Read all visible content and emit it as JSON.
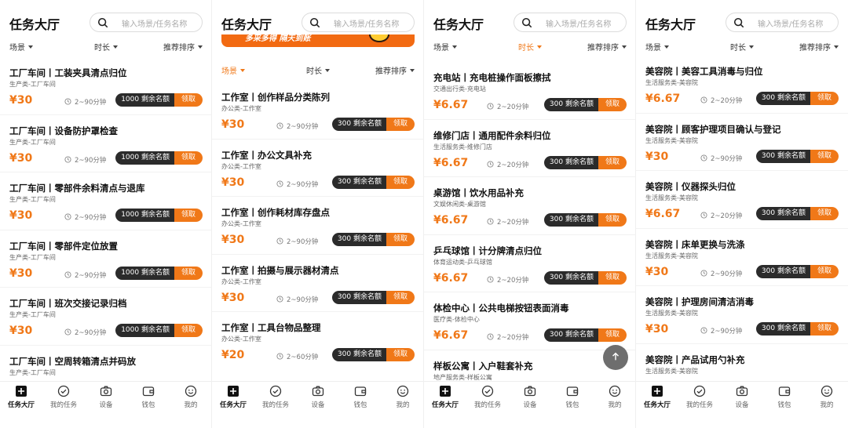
{
  "header": {
    "title": "任务大厅",
    "search_placeholder": "输入场景/任务名称"
  },
  "filters": {
    "scene": "场景",
    "duration": "时长",
    "sort": "推荐排序"
  },
  "banner": {
    "text": "多采多得 隔天到账"
  },
  "labels": {
    "remaining": "剩余名额",
    "claim": "领取"
  },
  "tabs": [
    "任务大厅",
    "我的任务",
    "设备",
    "钱包",
    "我的"
  ],
  "colors": {
    "accent": "#f07818",
    "quota_bg": "#2b2b2b",
    "fab": "#6e6e6e"
  },
  "fab_icon": "arrow-up-icon",
  "panels": [
    {
      "active_filter": "none",
      "tasks": [
        {
          "name": "工厂车间丨工装夹具清点归位",
          "category": "生产类-工厂车间",
          "price": "¥30",
          "time": "2~90分钟",
          "quota": "1000"
        },
        {
          "name": "工厂车间丨设备防护罩检查",
          "category": "生产类-工厂车间",
          "price": "¥30",
          "time": "2~90分钟",
          "quota": "1000"
        },
        {
          "name": "工厂车间丨零部件余料清点与退库",
          "category": "生产类-工厂车间",
          "price": "¥30",
          "time": "2~90分钟",
          "quota": "1000"
        },
        {
          "name": "工厂车间丨零部件定位放置",
          "category": "生产类-工厂车间",
          "price": "¥30",
          "time": "2~90分钟",
          "quota": "1000"
        },
        {
          "name": "工厂车间丨班次交接记录归档",
          "category": "生产类-工厂车间",
          "price": "¥30",
          "time": "2~90分钟",
          "quota": "1000"
        },
        {
          "name": "工厂车间丨空周转箱清点并码放",
          "category": "生产类-工厂车间",
          "price": "¥30",
          "time": "2~90分钟",
          "quota": "1000"
        }
      ]
    },
    {
      "active_filter": "scene",
      "tasks": [
        {
          "name": "工作室丨创作样品分类陈列",
          "category": "办公类-工作室",
          "price": "¥30",
          "time": "2~90分钟",
          "quota": "300"
        },
        {
          "name": "工作室丨办公文具补充",
          "category": "办公类-工作室",
          "price": "¥30",
          "time": "2~90分钟",
          "quota": "300"
        },
        {
          "name": "工作室丨创作耗材库存盘点",
          "category": "办公类-工作室",
          "price": "¥30",
          "time": "2~90分钟",
          "quota": "300"
        },
        {
          "name": "工作室丨拍摄与展示器材清点",
          "category": "办公类-工作室",
          "price": "¥30",
          "time": "2~90分钟",
          "quota": "300"
        },
        {
          "name": "工作室丨工具台物品整理",
          "category": "办公类-工作室",
          "price": "¥20",
          "time": "2~60分钟",
          "quota": "300"
        }
      ]
    },
    {
      "active_filter": "duration",
      "tasks": [
        {
          "name": "充电站丨充电桩操作面板擦拭",
          "category": "交通出行类-充电站",
          "price": "¥6.67",
          "time": "2~20分钟",
          "quota": "300"
        },
        {
          "name": "维修门店丨通用配件余料归位",
          "category": "生活服务类-维修门店",
          "price": "¥6.67",
          "time": "2~20分钟",
          "quota": "300"
        },
        {
          "name": "桌游馆丨饮水用品补充",
          "category": "文娱休闲类-桌游馆",
          "price": "¥6.67",
          "time": "2~20分钟",
          "quota": "300"
        },
        {
          "name": "乒乓球馆丨计分牌清点归位",
          "category": "体育运动类-乒乓球馆",
          "price": "¥6.67",
          "time": "2~20分钟",
          "quota": "300"
        },
        {
          "name": "体检中心丨公共电梯按钮表面消毒",
          "category": "医疗类-体检中心",
          "price": "¥6.67",
          "time": "2~20分钟",
          "quota": "300"
        },
        {
          "name": "样板公寓丨入户鞋套补充",
          "category": "地产服务类-样板公寓",
          "price": "",
          "time": "",
          "quota": ""
        }
      ]
    },
    {
      "active_filter": "none",
      "tasks": [
        {
          "name": "美容院丨美容工具消毒与归位",
          "category": "生活服务类-美容院",
          "price": "¥6.67",
          "time": "2~20分钟",
          "quota": "300"
        },
        {
          "name": "美容院丨顾客护理项目确认与登记",
          "category": "生活服务类-美容院",
          "price": "¥30",
          "time": "2~90分钟",
          "quota": "300"
        },
        {
          "name": "美容院丨仪器探头归位",
          "category": "生活服务类-美容院",
          "price": "¥6.67",
          "time": "2~20分钟",
          "quota": "300"
        },
        {
          "name": "美容院丨床单更换与洗涤",
          "category": "生活服务类-美容院",
          "price": "¥30",
          "time": "2~90分钟",
          "quota": "300"
        },
        {
          "name": "美容院丨护理房间清洁消毒",
          "category": "生活服务类-美容院",
          "price": "¥30",
          "time": "2~90分钟",
          "quota": "300"
        },
        {
          "name": "美容院丨产品试用勺补充",
          "category": "生活服务类-美容院",
          "price": "",
          "time": "",
          "quota": ""
        }
      ]
    }
  ]
}
